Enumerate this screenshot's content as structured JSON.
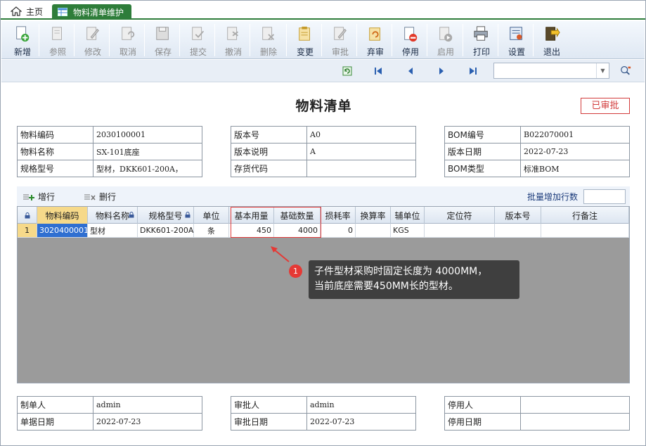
{
  "tabs": {
    "home": "主页",
    "active": "物料清单维护"
  },
  "toolbar": [
    {
      "label": "新增",
      "state": "en"
    },
    {
      "label": "参照",
      "state": "dis"
    },
    {
      "label": "修改",
      "state": "dis"
    },
    {
      "label": "取消",
      "state": "dis"
    },
    {
      "label": "保存",
      "state": "dis"
    },
    {
      "label": "提交",
      "state": "dis"
    },
    {
      "label": "撤消",
      "state": "dis"
    },
    {
      "label": "删除",
      "state": "dis"
    },
    {
      "label": "变更",
      "state": "en"
    },
    {
      "label": "审批",
      "state": "dis"
    },
    {
      "label": "弃审",
      "state": "en"
    },
    {
      "label": "停用",
      "state": "en"
    },
    {
      "label": "启用",
      "state": "dis"
    },
    {
      "label": "打印",
      "state": "en"
    },
    {
      "label": "设置",
      "state": "en"
    },
    {
      "label": "退出",
      "state": "en"
    }
  ],
  "nav": {
    "refresh": "⟳",
    "first": "⏮",
    "prev": "◀",
    "next": "▶",
    "last": "⏭",
    "search_value": ""
  },
  "doc": {
    "title": "物料清单",
    "status": "已审批"
  },
  "header_left": [
    {
      "k": "物料编码",
      "v": "2030100001"
    },
    {
      "k": "物料名称",
      "v": "SX-101底座"
    },
    {
      "k": "规格型号",
      "v": "型材，DKK601-200A，"
    }
  ],
  "header_mid": [
    {
      "k": "版本号",
      "v": "A0"
    },
    {
      "k": "版本说明",
      "v": "A"
    },
    {
      "k": "存货代码",
      "v": ""
    }
  ],
  "header_right": [
    {
      "k": "BOM编号",
      "v": "B022070001"
    },
    {
      "k": "版本日期",
      "v": "2022-07-23"
    },
    {
      "k": "BOM类型",
      "v": "标准BOM"
    }
  ],
  "grid_actions": {
    "add": "增行",
    "del": "删行",
    "batch": "批量增加行数",
    "batch_value": ""
  },
  "grid_columns": [
    "物料编码",
    "物料名称",
    "规格型号",
    "单位",
    "基本用量",
    "基础数量",
    "损耗率",
    "换算率",
    "辅单位",
    "定位符",
    "版本号",
    "行备注"
  ],
  "grid_rows": [
    {
      "no": "1",
      "code": "3020400001",
      "name": "型材",
      "spec": "DKK601-200A",
      "unit": "条",
      "qty": "450",
      "base": "4000",
      "loss": "0",
      "rate": "",
      "aux": "KGS",
      "pos": "",
      "ver": "",
      "note": ""
    }
  ],
  "callout": {
    "num": "1",
    "line1": "子件型材采购时固定长度为 4000MM，",
    "line2": "当前底座需要450MM长的型材。"
  },
  "footer_left": [
    {
      "k": "制单人",
      "v": "admin"
    },
    {
      "k": "单据日期",
      "v": "2022-07-23"
    }
  ],
  "footer_mid": [
    {
      "k": "审批人",
      "v": "admin"
    },
    {
      "k": "审批日期",
      "v": "2022-07-23"
    }
  ],
  "footer_right": [
    {
      "k": "停用人",
      "v": ""
    },
    {
      "k": "停用日期",
      "v": ""
    }
  ]
}
